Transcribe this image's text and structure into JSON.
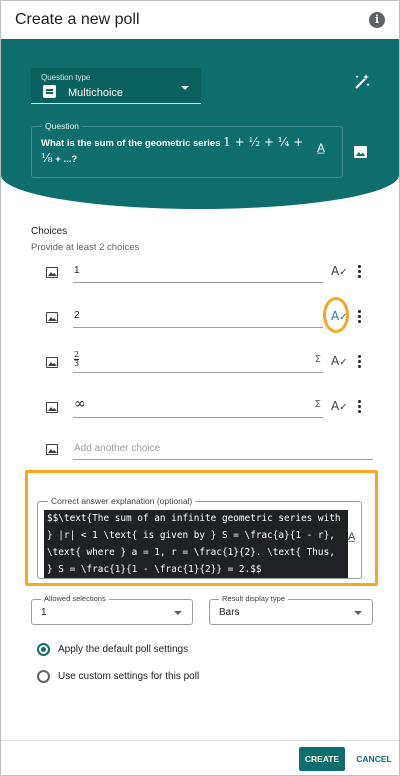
{
  "window": {
    "title": "Create a new poll"
  },
  "question_type": {
    "label": "Question type",
    "value": "Multichoice"
  },
  "question": {
    "label": "Question",
    "text_prefix": "What is the sum of the geometric series ",
    "math": "1 + ½ + ¼ +",
    "math_line2": "⅛",
    "text_suffix": "+ ...?"
  },
  "choices": {
    "title": "Choices",
    "hint": "Provide at least 2 choices",
    "items": [
      {
        "value": "1"
      },
      {
        "value": "2"
      },
      {
        "value_num": "2",
        "value_den": "3"
      },
      {
        "value": "∞"
      }
    ],
    "add_placeholder": "Add another choice"
  },
  "explanation": {
    "label": "Correct answer explanation (optional)",
    "value": "$$\\text{The sum of an infinite geometric series with } |r| < 1 \\text{ is given by } S = \\frac{a}{1 - r}, \\text{ where } a = 1, r = \\frac{1}{2}. \\text{ Thus, } S = \\frac{1}{1 - \\frac{1}{2}} = 2.$$"
  },
  "allowed_selections": {
    "label": "Allowed selections",
    "value": "1"
  },
  "result_display": {
    "label": "Result display type",
    "value": "Bars"
  },
  "settings": {
    "default_label": "Apply the default poll settings",
    "custom_label": "Use custom settings for this poll"
  },
  "footer": {
    "create_label": "CREATE",
    "cancel_label": "CANCEL"
  },
  "icons": {
    "info": "info-icon",
    "wand": "magic-wand-icon",
    "image": "image-icon",
    "spellcheck": "spellcheck-icon",
    "more": "more-vert-icon",
    "sigma": "sigma-icon",
    "text_format": "text-format-icon"
  },
  "colors": {
    "primary": "#0e6d6d",
    "highlight": "#f5a623"
  }
}
